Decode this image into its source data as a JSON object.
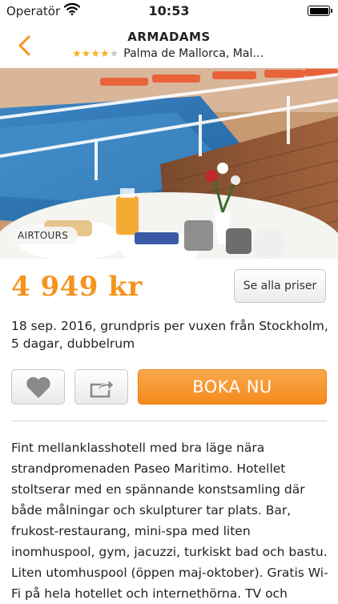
{
  "status_bar": {
    "carrier": "Operatör",
    "time": "10:53"
  },
  "nav": {
    "title": "ARMADAMS",
    "rating": 4,
    "max_rating": 5,
    "location": "Palma de Mallorca, Mal…",
    "accent_color": "#f5941d"
  },
  "hero": {
    "badge": "AIRTOURS"
  },
  "offer": {
    "price": "4 949 kr",
    "all_prices_label": "Se alla priser",
    "details": "18 sep. 2016, grundpris per vuxen från Stockholm, 5 dagar, dubbelrum"
  },
  "actions": {
    "favorite_icon": "heart-icon",
    "share_icon": "share-icon",
    "book_label": "BOKA NU",
    "book_color": "#f5941d"
  },
  "description": "Fint mellanklasshotell med bra läge nära strandpromenaden Paseo Maritimo. Hotellet stoltserar med en spännande konstsamling där både målningar och skulpturer tar plats. Bar, frukost-restaurang, mini-spa med liten inomhuspool, gym, jacuzzi, turkiskt bad och bastu. Liten utomhuspool (öppen maj-oktober). Gratis Wi-Fi på hela hotellet och internethörna. TV och"
}
